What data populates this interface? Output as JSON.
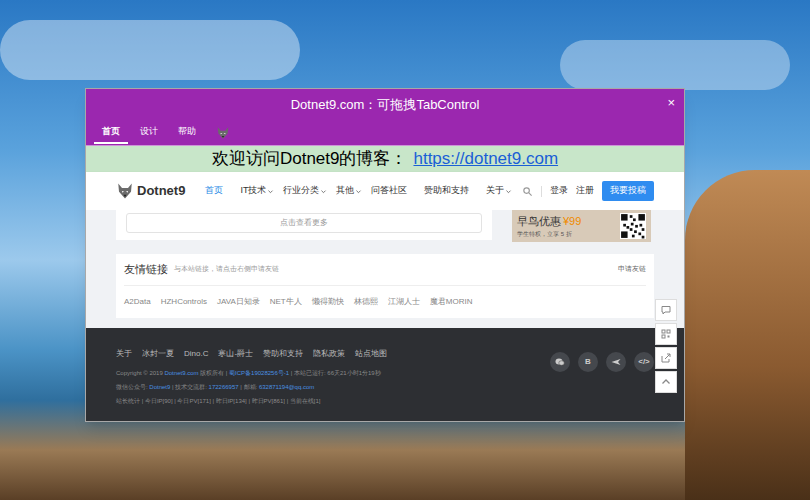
{
  "window": {
    "title": "Dotnet9.com：可拖拽TabControl",
    "close": "×"
  },
  "tabs": [
    {
      "label": "首页",
      "selected": true
    },
    {
      "label": "设计",
      "selected": false
    },
    {
      "label": "帮助",
      "selected": false
    }
  ],
  "banner": {
    "text": "欢迎访问Dotnet9的博客：",
    "link": "https://dotnet9.com"
  },
  "site": {
    "logo": "Dotnet9",
    "nav": [
      {
        "label": "首页",
        "selected": true,
        "dropdown": false
      },
      {
        "label": "IT技术",
        "selected": false,
        "dropdown": true
      },
      {
        "label": "行业分类",
        "selected": false,
        "dropdown": true
      },
      {
        "label": "其他",
        "selected": false,
        "dropdown": true
      },
      {
        "label": "问答社区",
        "selected": false,
        "dropdown": false
      },
      {
        "label": "赞助和支持",
        "selected": false,
        "dropdown": false
      },
      {
        "label": "关于",
        "selected": false,
        "dropdown": true
      }
    ],
    "login": "登录",
    "register": "注册",
    "submit": "我要投稿",
    "more": "点击查看更多",
    "promo": {
      "title": "早鸟优惠",
      "price": "¥99",
      "subtitle": "学生特权，立享 5 折"
    },
    "friends": {
      "title": "友情链接",
      "hint": "与本站链接，请点击右侧申请友链",
      "apply": "申请友链",
      "links": [
        "A2Data",
        "HZHControls",
        "JAVA日知录",
        "NET牛人",
        "懒得勤快",
        "林德熙",
        "江湖人士",
        "魔君MORIN"
      ]
    },
    "footer": {
      "links": [
        "关于",
        "冰封一夏",
        "Dino.C",
        "寒山-爵士",
        "赞助和支持",
        "隐私政策",
        "站点地图"
      ],
      "lines": [
        [
          {
            "text": "Copyright © 2019 ",
            "link": false
          },
          {
            "text": "Dotnet9.com",
            "link": true
          },
          {
            "text": " 版权所有 | ",
            "link": false
          },
          {
            "text": "蜀ICP备19028256号-1",
            "link": true
          },
          {
            "text": " | 本站已运行: 66天21小时1分19秒",
            "link": false
          }
        ],
        [
          {
            "text": "微信公众号: ",
            "link": false
          },
          {
            "text": "Dotnet9",
            "link": true
          },
          {
            "text": " | 技术交流群: ",
            "link": false
          },
          {
            "text": "172266957",
            "link": true
          },
          {
            "text": " | 邮箱: ",
            "link": false
          },
          {
            "text": "632871194@qq.com",
            "link": true
          }
        ],
        [
          {
            "text": "站长统计 | 今日IP[90] | 今日PV[171] | 昨日IP[134] | 昨日PV[861] | 当前在线[1]",
            "link": false
          }
        ]
      ],
      "social": [
        {
          "kind": "wechat"
        },
        {
          "kind": "text",
          "label": "B"
        },
        {
          "kind": "bird"
        },
        {
          "kind": "text",
          "label": "</>"
        }
      ]
    }
  }
}
